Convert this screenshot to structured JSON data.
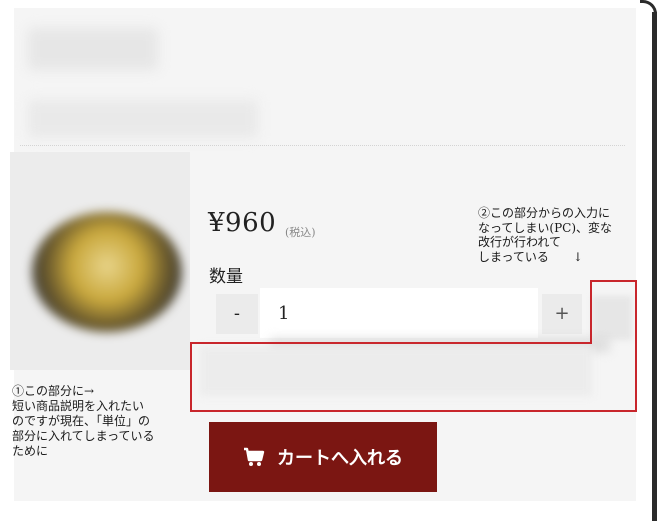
{
  "product": {
    "price": "¥960",
    "tax_note": "(税込)",
    "quantity_label": "数量",
    "quantity_value": "1",
    "quantity_minus": "-",
    "quantity_plus": "+"
  },
  "cart": {
    "button_label": "カートへ入れる",
    "icon": "cart-icon"
  },
  "annotations": {
    "note1": "①この部分に→\n短い商品説明を入れたい\nのですが現在、「単位」の\n部分に入れてしまっている\nために",
    "note2": "②この部分からの入力に\nなってしまい(PC)、変な\n改行が行われて\nしまっている　　↓"
  },
  "colors": {
    "accent": "#7b1612",
    "annotation_line": "#c8262c",
    "panel": "#f5f5f5"
  }
}
